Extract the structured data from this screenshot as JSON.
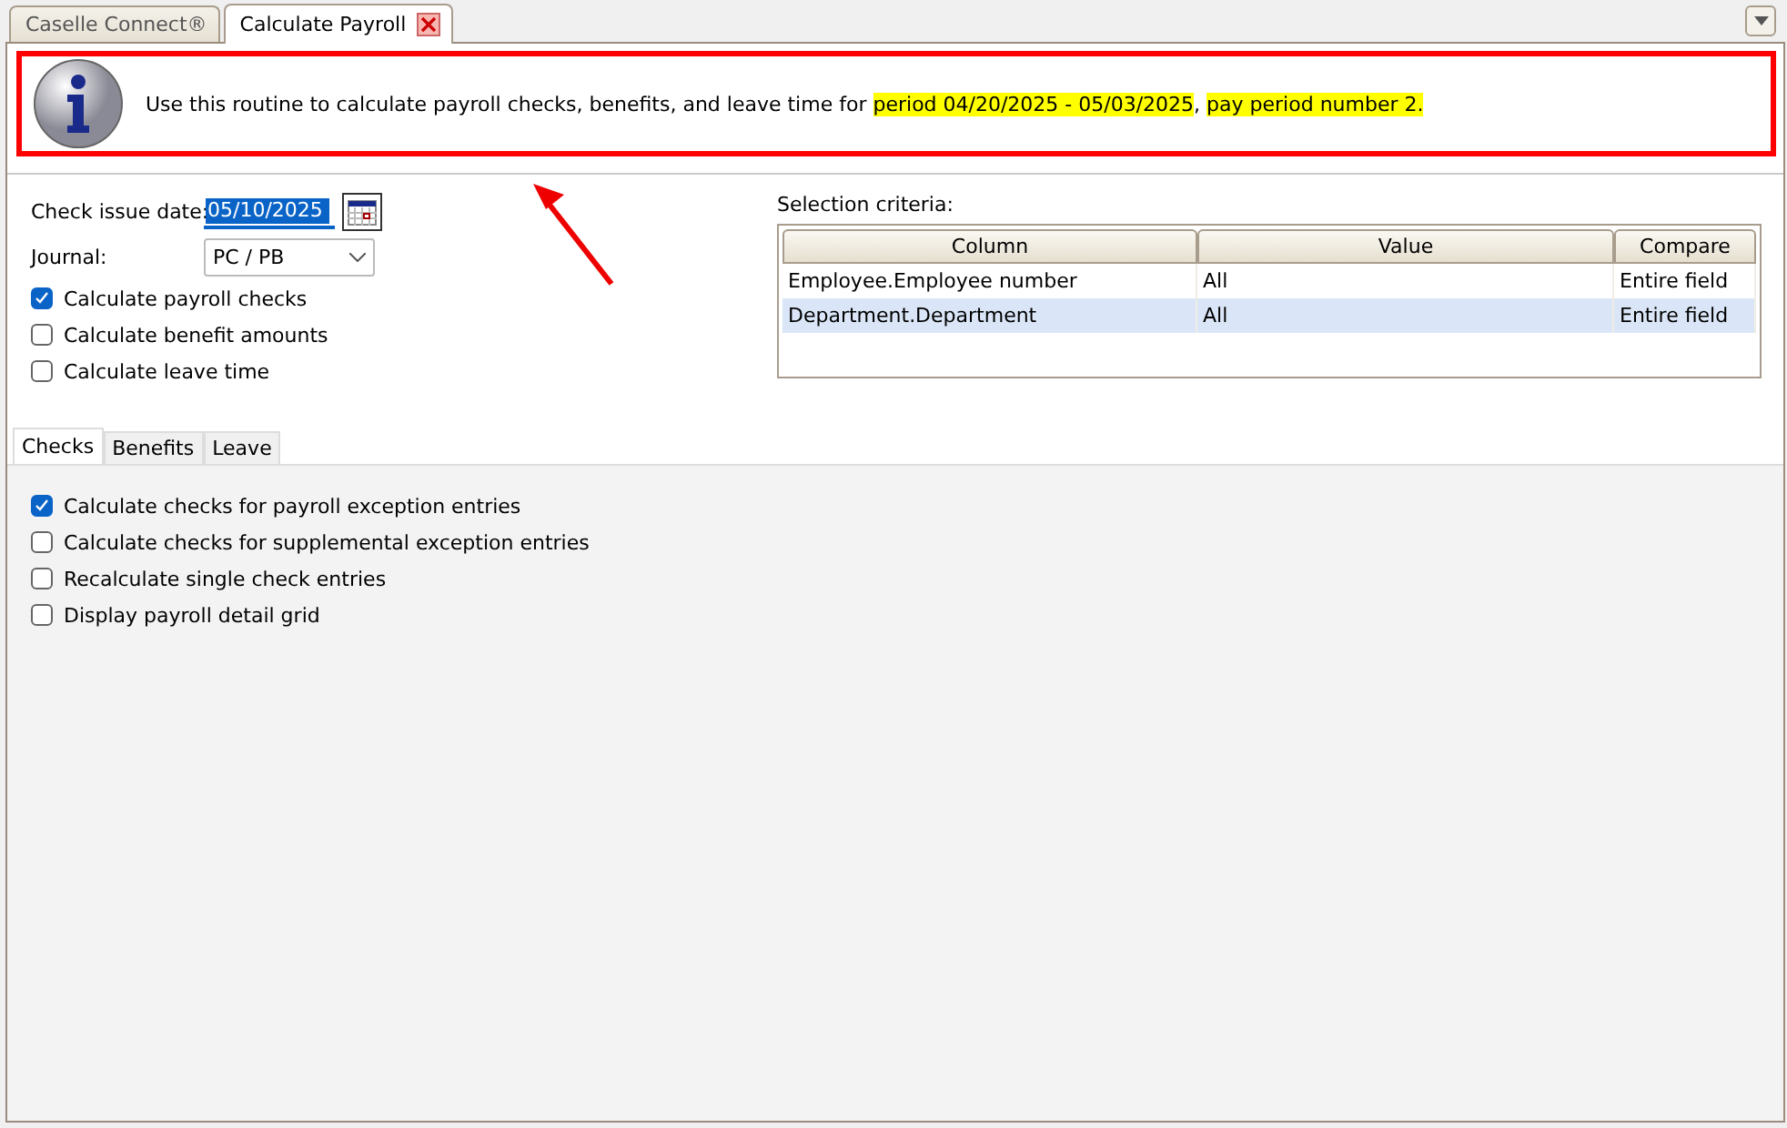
{
  "doc_tabs": [
    {
      "label": "Caselle Connect®",
      "selected": false,
      "closable": false
    },
    {
      "label": "Calculate Payroll",
      "selected": true,
      "closable": true
    }
  ],
  "banner": {
    "segments": [
      {
        "text": "Use this routine to calculate payroll checks, benefits, and leave time for",
        "highlighted": false
      },
      {
        "text": "period 04/20/2025 - 05/03/2025",
        "highlighted": true
      },
      {
        "text": ", ",
        "highlighted": false
      },
      {
        "text": "pay period number 2.",
        "highlighted": true
      }
    ]
  },
  "form": {
    "check_issue_date": {
      "label": "Check issue date:",
      "value": "05/10/2025"
    },
    "journal": {
      "label": "Journal:",
      "value": "PC / PB"
    },
    "options": [
      {
        "label": "Calculate payroll checks",
        "checked": true
      },
      {
        "label": "Calculate benefit amounts",
        "checked": false
      },
      {
        "label": "Calculate leave time",
        "checked": false
      }
    ]
  },
  "selection_criteria": {
    "label": "Selection criteria:",
    "columns": [
      "Column",
      "Value",
      "Compare"
    ],
    "rows": [
      {
        "cells": [
          "Employee.Employee number",
          "All",
          "Entire field"
        ],
        "selected": false
      },
      {
        "cells": [
          "Department.Department",
          "All",
          "Entire field"
        ],
        "selected": true
      }
    ]
  },
  "tabs": [
    {
      "label": "Checks",
      "selected": true
    },
    {
      "label": "Benefits",
      "selected": false
    },
    {
      "label": "Leave",
      "selected": false
    }
  ],
  "check_options": [
    {
      "label": "Calculate checks for payroll exception entries",
      "checked": true
    },
    {
      "label": "Calculate checks for supplemental exception entries",
      "checked": false
    },
    {
      "label": "Recalculate single check entries",
      "checked": false
    },
    {
      "label": "Display payroll detail grid",
      "checked": false
    }
  ]
}
